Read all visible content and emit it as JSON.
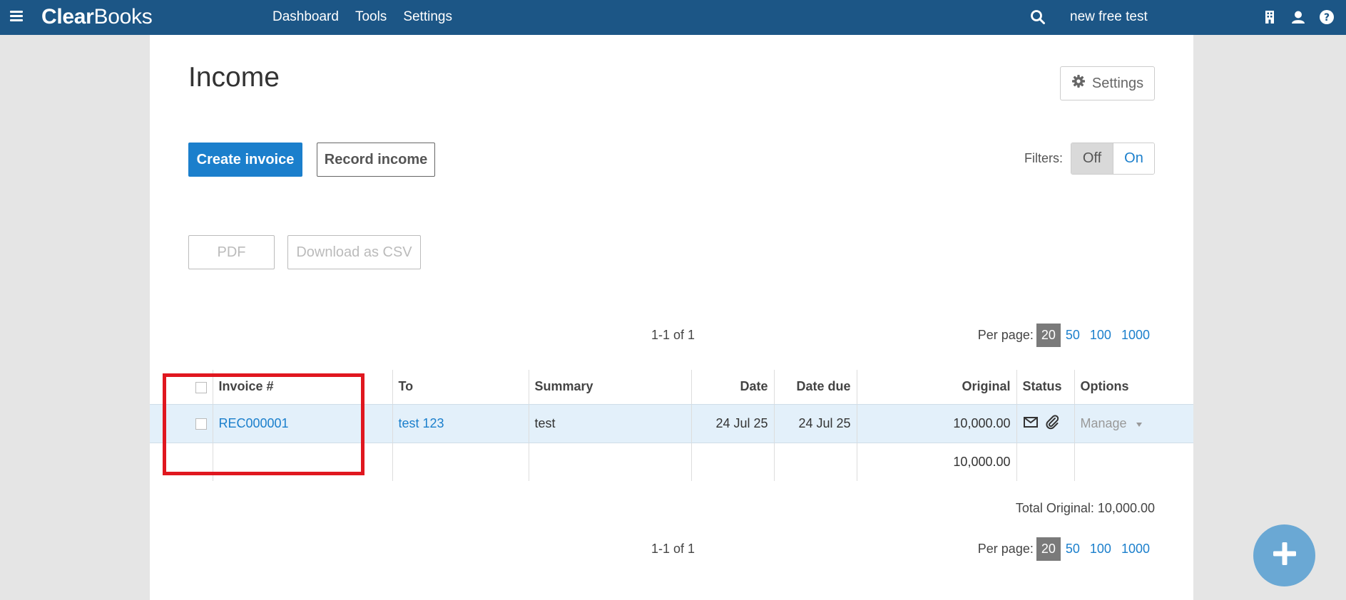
{
  "topbar": {
    "logo_bold": "Clear",
    "logo_rest": "Books",
    "nav": [
      "Dashboard",
      "Tools",
      "Settings"
    ],
    "company": "new free test"
  },
  "page": {
    "title": "Income",
    "settings_label": "Settings"
  },
  "actions": {
    "create_invoice": "Create invoice",
    "record_income": "Record income",
    "pdf": "PDF",
    "download_csv": "Download as CSV"
  },
  "filters": {
    "label": "Filters:",
    "off": "Off",
    "on": "On",
    "selected": "Off"
  },
  "pagination": {
    "count": "1-1 of 1",
    "per_page_label": "Per page:",
    "options": [
      "20",
      "50",
      "100",
      "1000"
    ],
    "selected": "20"
  },
  "table": {
    "columns": [
      "Invoice #",
      "To",
      "Summary",
      "Date",
      "Date due",
      "Original",
      "Status",
      "Options"
    ],
    "rows": [
      {
        "invoice": "REC000001",
        "to": "test 123",
        "summary": "test",
        "date": "24 Jul 25",
        "date_due": "24 Jul 25",
        "original": "10,000.00",
        "options": "Manage"
      }
    ],
    "total_row_original": "10,000.00"
  },
  "total_original": "Total Original: 10,000.00",
  "colors": {
    "topbar": "#1c5686",
    "primary": "#1b7fcc",
    "row_highlight": "#e3f0fa",
    "annotation": "#e0171f",
    "fab": "#6aa8d4"
  },
  "icons": [
    "menu-icon",
    "search-icon",
    "building-icon",
    "user-icon",
    "help-icon",
    "gear-icon",
    "envelope-icon",
    "paperclip-icon",
    "caret-down-icon",
    "plus-icon"
  ]
}
